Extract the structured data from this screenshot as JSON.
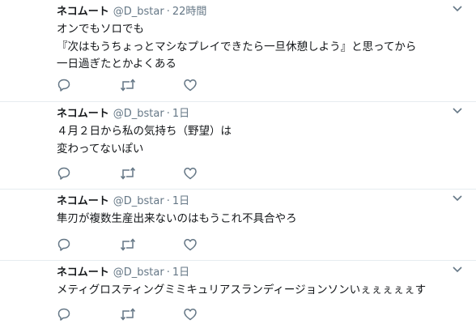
{
  "tweets": [
    {
      "name": "ネコムート",
      "handle": "@D_bstar",
      "sep": "·",
      "time": "22時間",
      "lines": [
        "オンでもソロでも",
        "『次はもうちょっとマシなプレイできたら一旦休憩しよう』と思ってから",
        "一日過ぎたとかよくある"
      ]
    },
    {
      "name": "ネコムート",
      "handle": "@D_bstar",
      "sep": "·",
      "time": "1日",
      "lines": [
        "４月２日から私の気持ち（野望）は",
        "変わってないぽい"
      ]
    },
    {
      "name": "ネコムート",
      "handle": "@D_bstar",
      "sep": "·",
      "time": "1日",
      "lines": [
        "隼刃が複数生産出来ないのはもうこれ不具合やろ"
      ]
    },
    {
      "name": "ネコムート",
      "handle": "@D_bstar",
      "sep": "·",
      "time": "1日",
      "lines": [
        "メティグロスティングミミキュリアスランディージョンソンいぇぇぇぇぇす"
      ]
    }
  ],
  "icons": {
    "reply": "reply-icon",
    "retweet": "retweet-icon",
    "like": "like-icon",
    "menu": "chevron-down-icon"
  },
  "colors": {
    "text": "#14171a",
    "muted": "#657786",
    "divider": "#e6ecf0"
  }
}
